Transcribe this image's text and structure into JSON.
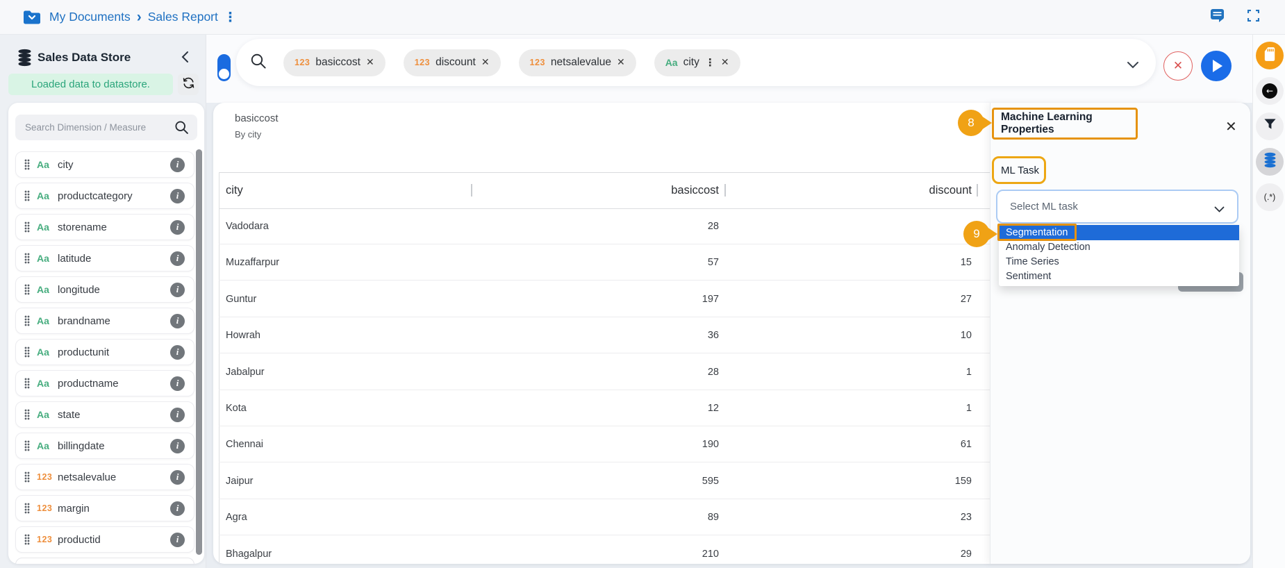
{
  "topbar": {
    "breadcrumb": {
      "root": "My Documents",
      "separator": "›",
      "current": "Sales Report",
      "menu_dots": "⋮"
    }
  },
  "sidebar": {
    "title": "Sales Data Store",
    "status_message": "Loaded data to datastore.",
    "search_placeholder": "Search Dimension / Measure",
    "fields": [
      {
        "label": "city",
        "kind": "Aa"
      },
      {
        "label": "productcategory",
        "kind": "Aa"
      },
      {
        "label": "storename",
        "kind": "Aa"
      },
      {
        "label": "latitude",
        "kind": "Aa"
      },
      {
        "label": "longitude",
        "kind": "Aa"
      },
      {
        "label": "brandname",
        "kind": "Aa"
      },
      {
        "label": "productunit",
        "kind": "Aa"
      },
      {
        "label": "productname",
        "kind": "Aa"
      },
      {
        "label": "state",
        "kind": "Aa"
      },
      {
        "label": "billingdate",
        "kind": "Aa"
      },
      {
        "label": "netsalevalue",
        "kind": "123"
      },
      {
        "label": "margin",
        "kind": "123"
      },
      {
        "label": "productid",
        "kind": "123"
      }
    ],
    "info_glyph": "i"
  },
  "query_bar": {
    "chips": [
      {
        "label": "basiccost",
        "kind": "123",
        "close": "✕"
      },
      {
        "label": "discount",
        "kind": "123",
        "close": "✕"
      },
      {
        "label": "netsalevalue",
        "kind": "123",
        "close": "✕"
      },
      {
        "label": "city",
        "kind": "Aa",
        "menu": "⋮",
        "close": "✕"
      }
    ],
    "clear_glyph": "✕"
  },
  "table": {
    "title": "basiccost",
    "subtitle": "By city",
    "columns": [
      "city",
      "basiccost",
      "discount"
    ],
    "rows": [
      {
        "city": "Vadodara",
        "basiccost": "28",
        "discount": ""
      },
      {
        "city": "Muzaffarpur",
        "basiccost": "57",
        "discount": "15"
      },
      {
        "city": "Guntur",
        "basiccost": "197",
        "discount": "27"
      },
      {
        "city": "Howrah",
        "basiccost": "36",
        "discount": "10"
      },
      {
        "city": "Jabalpur",
        "basiccost": "28",
        "discount": "1"
      },
      {
        "city": "Kota",
        "basiccost": "12",
        "discount": "1"
      },
      {
        "city": "Chennai",
        "basiccost": "190",
        "discount": "61"
      },
      {
        "city": "Jaipur",
        "basiccost": "595",
        "discount": "159"
      },
      {
        "city": "Agra",
        "basiccost": "89",
        "discount": "23"
      },
      {
        "city": "Bhagalpur",
        "basiccost": "210",
        "discount": "29"
      }
    ]
  },
  "ml_panel": {
    "title": "Machine Learning Properties",
    "close_glyph": "✕",
    "task_label": "ML Task",
    "select_placeholder": "Select ML task",
    "options": [
      "Segmentation",
      "Anomaly Detection",
      "Time Series",
      "Sentiment"
    ],
    "highlighted_option": "Segmentation"
  },
  "annotations": {
    "step8": "8",
    "step9": "9"
  },
  "right_toolbar": {
    "regex_label": "(.*)",
    "back_glyph": "←"
  },
  "colors": {
    "accent_blue": "#1a6ce8",
    "breadcrumb_blue": "#1f71c2",
    "highlight_blue": "#1e6bd8",
    "annotation_orange": "#e69310",
    "badge_orange": "#f0a215",
    "measure_orange": "#ee8f3d",
    "dimension_green": "#47ad7f",
    "status_green": "#2ba57b"
  }
}
